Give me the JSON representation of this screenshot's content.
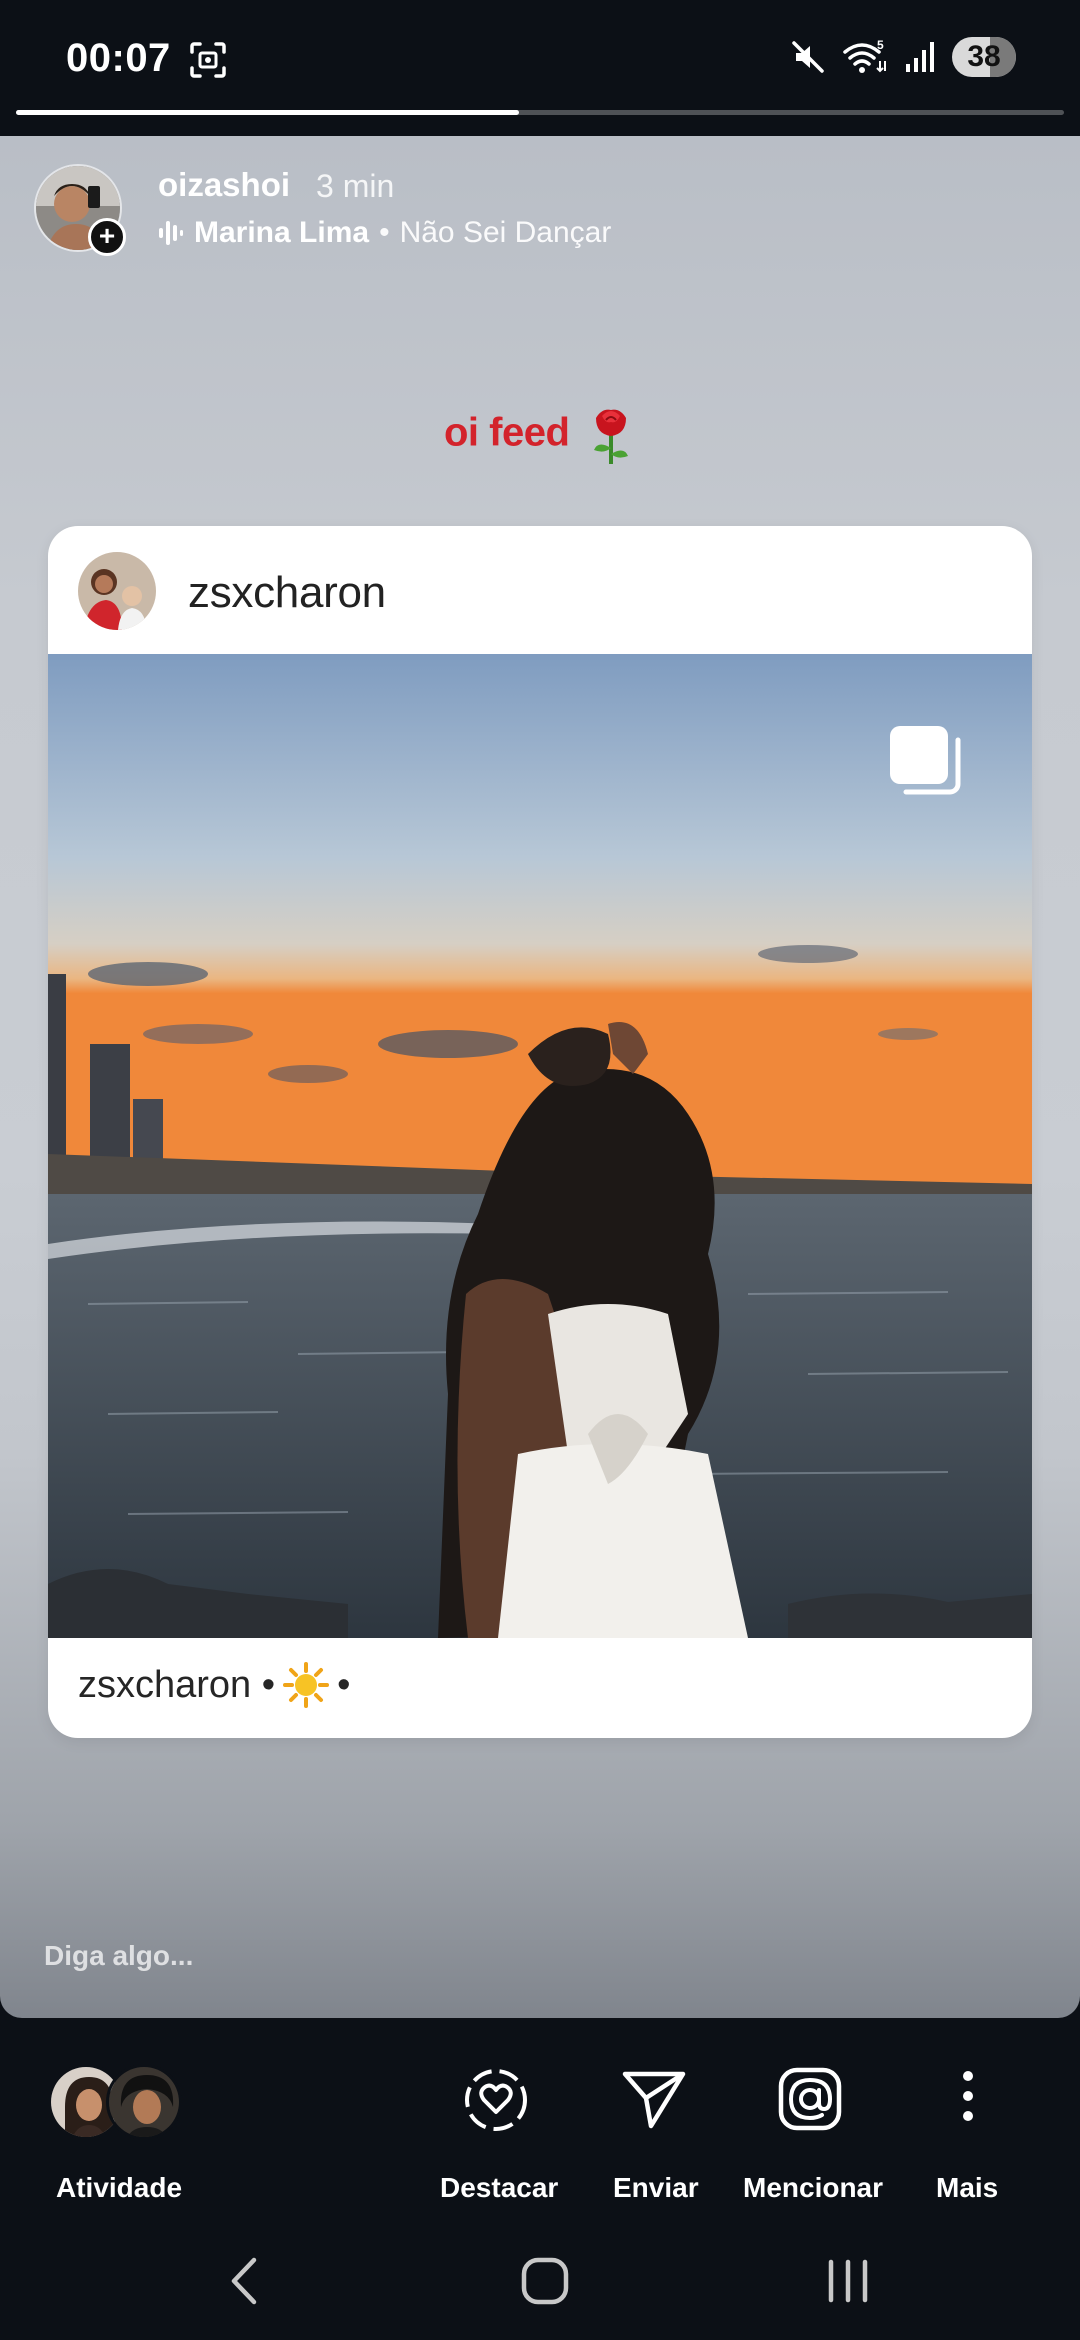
{
  "status_bar": {
    "time": "00:07",
    "battery": "38"
  },
  "story": {
    "progress": 0.48,
    "username": "oizashoi",
    "time_ago": "3 min",
    "music": {
      "artist": "Marina Lima",
      "separator": "•",
      "song": "Não Sei Dançar"
    },
    "caption": "oi feed"
  },
  "shared_post": {
    "username": "zsxcharon",
    "footer_prefix": "zsxcharon •",
    "footer_suffix": "•"
  },
  "reply": {
    "placeholder": "Diga algo..."
  },
  "actions": {
    "activity": "Atividade",
    "highlight": "Destacar",
    "send": "Enviar",
    "mention": "Mencionar",
    "more": "Mais"
  },
  "icons": {
    "screenshot": "screenshot-icon",
    "mute": "mute-icon",
    "wifi": "wifi-icon",
    "signal": "signal-icon",
    "rose": "rose-emoji-icon",
    "carousel": "carousel-icon",
    "sun": "sun-emoji-icon"
  },
  "colors": {
    "caption": "#d3232b",
    "bar_background": "#0c1016"
  }
}
